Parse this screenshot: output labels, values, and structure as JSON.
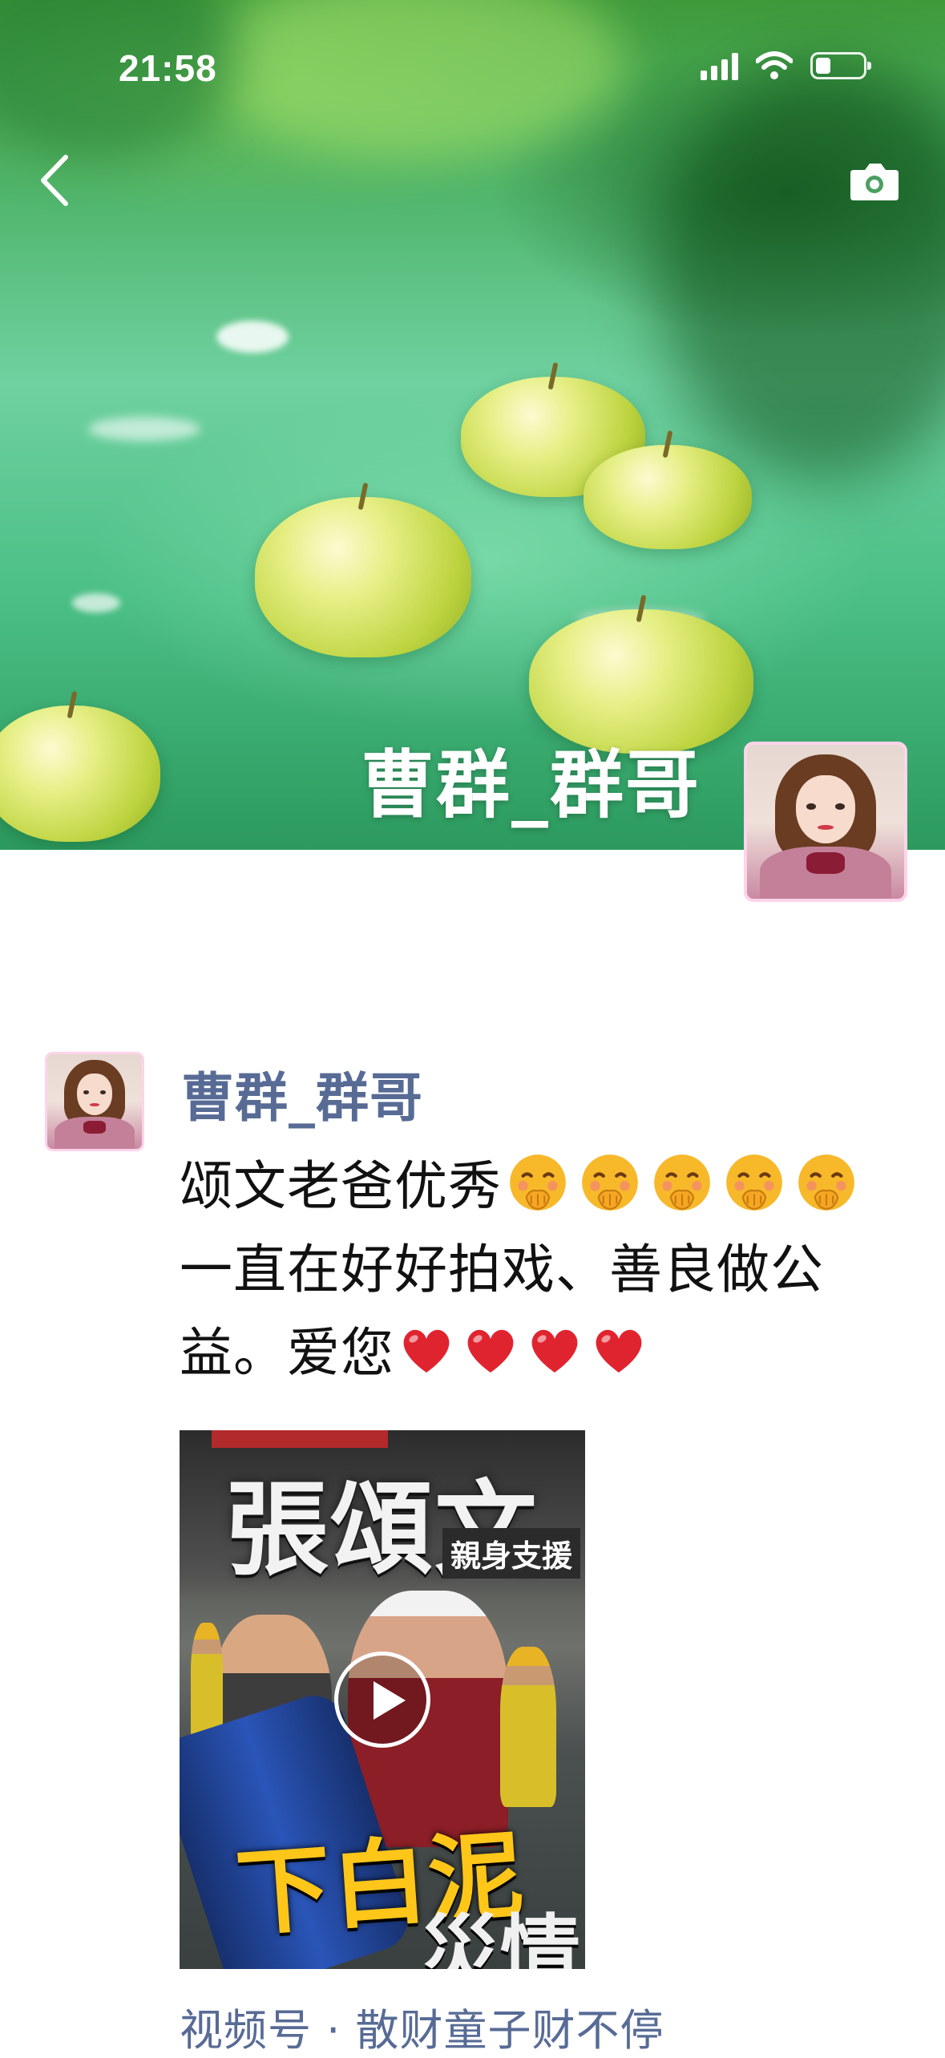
{
  "status_bar": {
    "time": "21:58"
  },
  "cover": {
    "name": "曹群_群哥"
  },
  "post": {
    "username": "曹群_群哥",
    "text_parts": [
      "颂文老爸优秀",
      "一直在好好拍戏、善良做公益。爱您"
    ],
    "emojis": {
      "shush_count": 5,
      "heart_count": 4
    },
    "video": {
      "title": "張頌文",
      "subtitle": "親身支援",
      "caption_line1": "下白泥",
      "caption_line2": "災情"
    },
    "channel_link": "视频号 · 散财童子财不停"
  }
}
